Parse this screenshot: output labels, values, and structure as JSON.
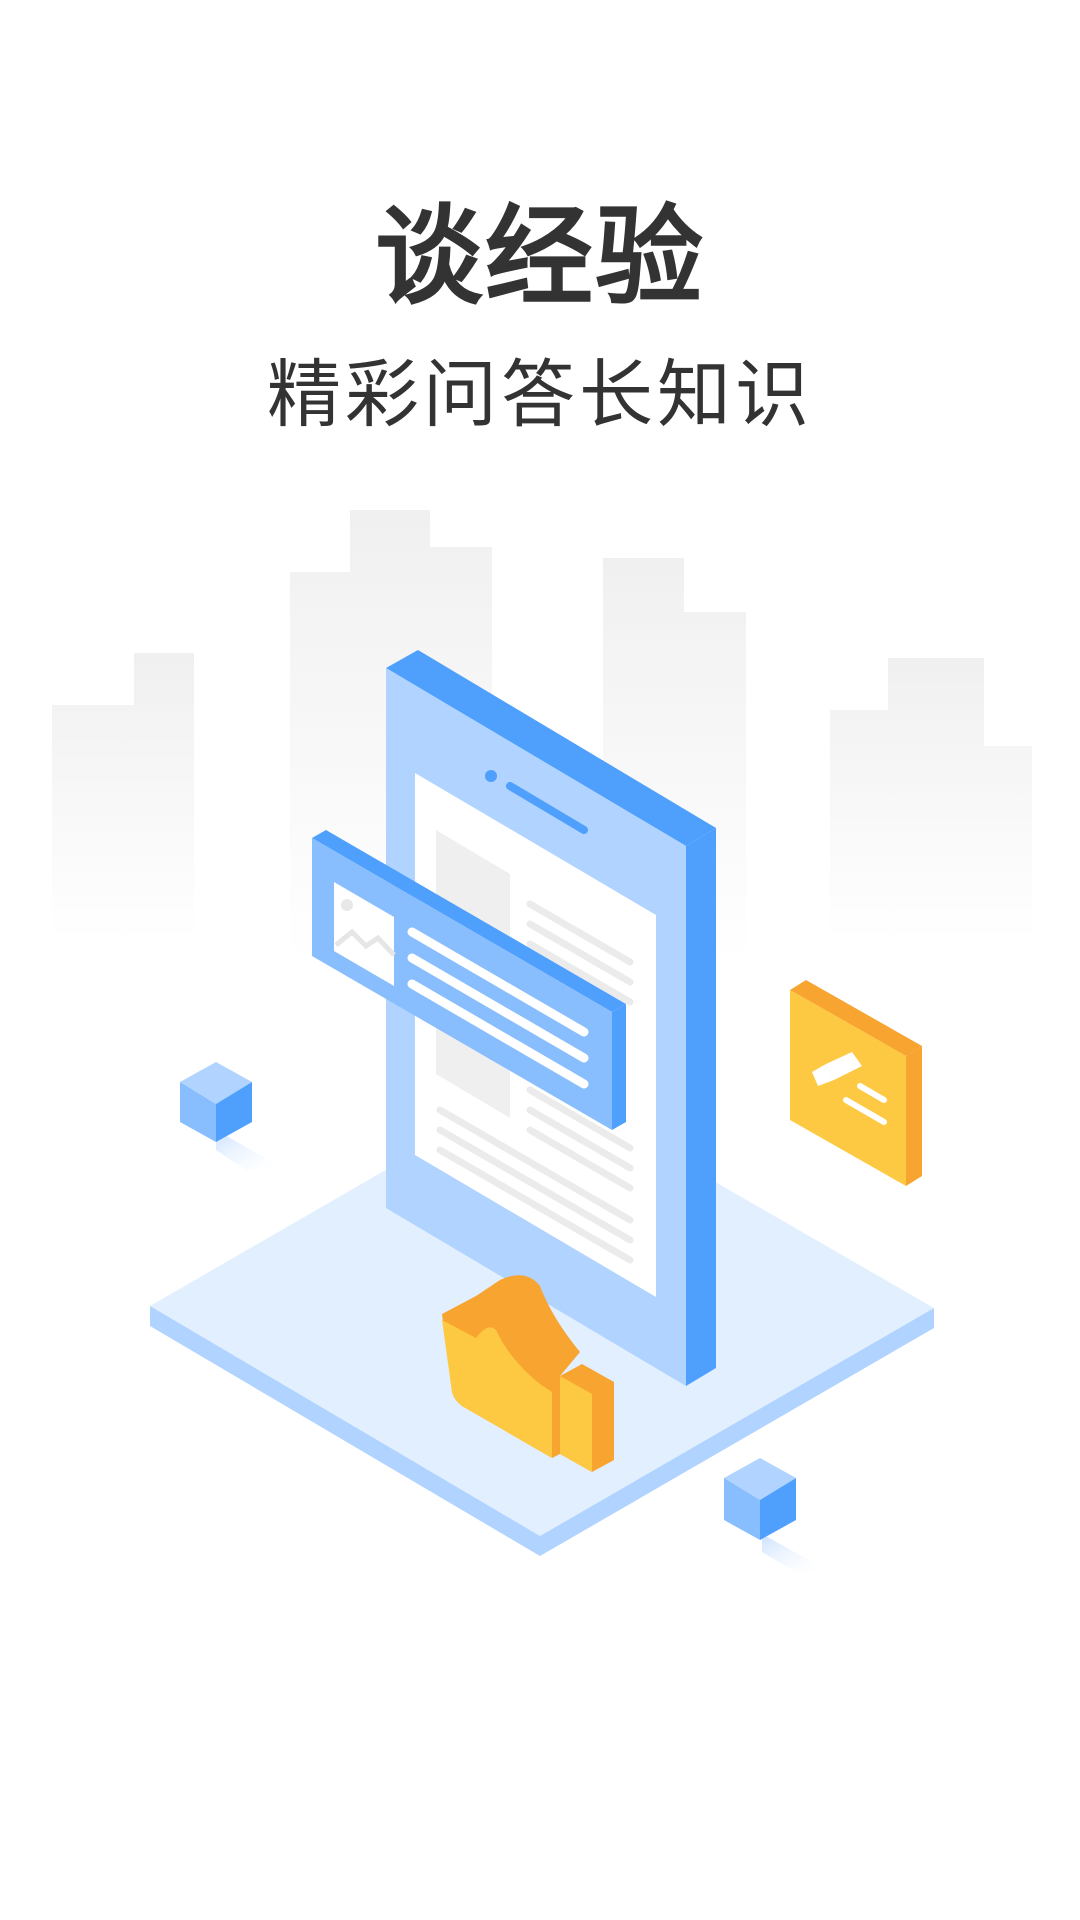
{
  "onboarding": {
    "title": "谈经验",
    "subtitle": "精彩问答长知识"
  },
  "colors": {
    "background": "#ffffff",
    "text": "#333333",
    "accent_blue": "#4f9ffd",
    "light_blue": "#b0d3ff",
    "pale_blue": "#e2efff",
    "accent_yellow": "#fec942",
    "accent_orange": "#f8a431",
    "building_gray": "#f2f2f2"
  },
  "illustration": {
    "icons": [
      "city-skyline",
      "tablet-device",
      "article-card",
      "pencil-note-card",
      "thumbs-up",
      "cube"
    ]
  }
}
